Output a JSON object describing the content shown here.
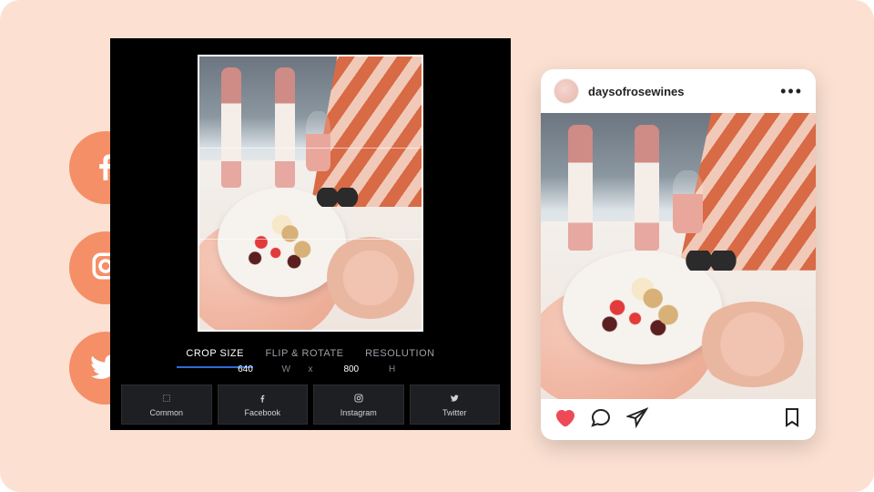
{
  "social_icons": [
    "facebook",
    "instagram",
    "twitter"
  ],
  "editor": {
    "tabs": {
      "crop": "CROP SIZE",
      "flip": "FLIP & ROTATE",
      "res": "RESOLUTION"
    },
    "active_tab": "crop",
    "width_value": "640",
    "width_label": "W",
    "sep": "x",
    "height_value": "800",
    "height_label": "H",
    "presets": {
      "common": "Common",
      "facebook": "Facebook",
      "instagram": "Instagram",
      "twitter": "Twitter"
    }
  },
  "instagram": {
    "username": "daysofrosewines"
  },
  "colors": {
    "accent": "#F48F68",
    "heart": "#ed4956"
  }
}
